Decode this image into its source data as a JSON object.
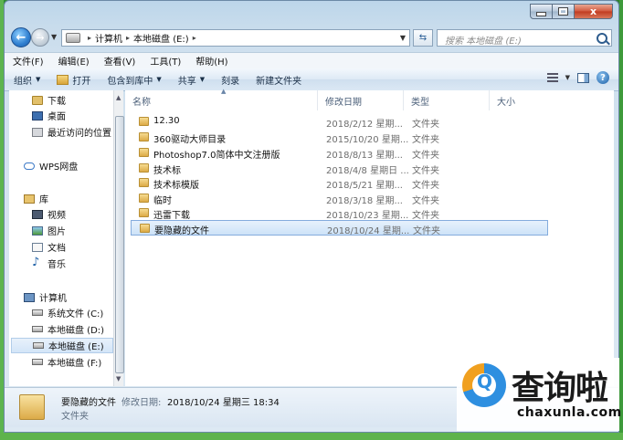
{
  "window": {
    "caption": {
      "minimize": "",
      "maximize": "",
      "close": "x"
    }
  },
  "address_bar": {
    "crumbs": [
      "计算机",
      "本地磁盘 (E:)"
    ],
    "search_placeholder": "搜索 本地磁盘 (E:)"
  },
  "menu": [
    "文件(F)",
    "编辑(E)",
    "查看(V)",
    "工具(T)",
    "帮助(H)"
  ],
  "toolbar": {
    "organize": "组织",
    "open": "打开",
    "include_in_library": "包含到库中",
    "share": "共享",
    "burn": "刻录",
    "new_folder": "新建文件夹"
  },
  "nav_pane": {
    "favorites": [
      "下载",
      "桌面",
      "最近访问的位置"
    ],
    "wps": "WPS网盘",
    "library": "库",
    "libraries": [
      "视频",
      "图片",
      "文档",
      "音乐"
    ],
    "computer": "计算机",
    "drives": [
      "系统文件 (C:)",
      "本地磁盘 (D:)",
      "本地磁盘 (E:)",
      "本地磁盘 (F:)"
    ],
    "selected": "本地磁盘 (E:)"
  },
  "columns": [
    "名称",
    "修改日期",
    "类型",
    "大小"
  ],
  "files": [
    {
      "name": "12.30",
      "date": "2018/2/12 星期...",
      "type": "文件夹"
    },
    {
      "name": "360驱动大师目录",
      "date": "2015/10/20 星期...",
      "type": "文件夹"
    },
    {
      "name": "Photoshop7.0简体中文注册版",
      "date": "2018/8/13 星期...",
      "type": "文件夹"
    },
    {
      "name": "技术标",
      "date": "2018/4/8 星期日 ...",
      "type": "文件夹"
    },
    {
      "name": "技术标模版",
      "date": "2018/5/21 星期...",
      "type": "文件夹"
    },
    {
      "name": "临时",
      "date": "2018/3/18 星期...",
      "type": "文件夹"
    },
    {
      "name": "迅雷下载",
      "date": "2018/10/23 星期...",
      "type": "文件夹"
    },
    {
      "name": "要隐藏的文件",
      "date": "2018/10/24 星期...",
      "type": "文件夹"
    }
  ],
  "details": {
    "name": "要隐藏的文件",
    "modified_label": "修改日期:",
    "modified_value": "2018/10/24 星期三 18:34",
    "type": "文件夹"
  },
  "watermark": {
    "title": "查询啦",
    "url": "chaxunla.com"
  }
}
